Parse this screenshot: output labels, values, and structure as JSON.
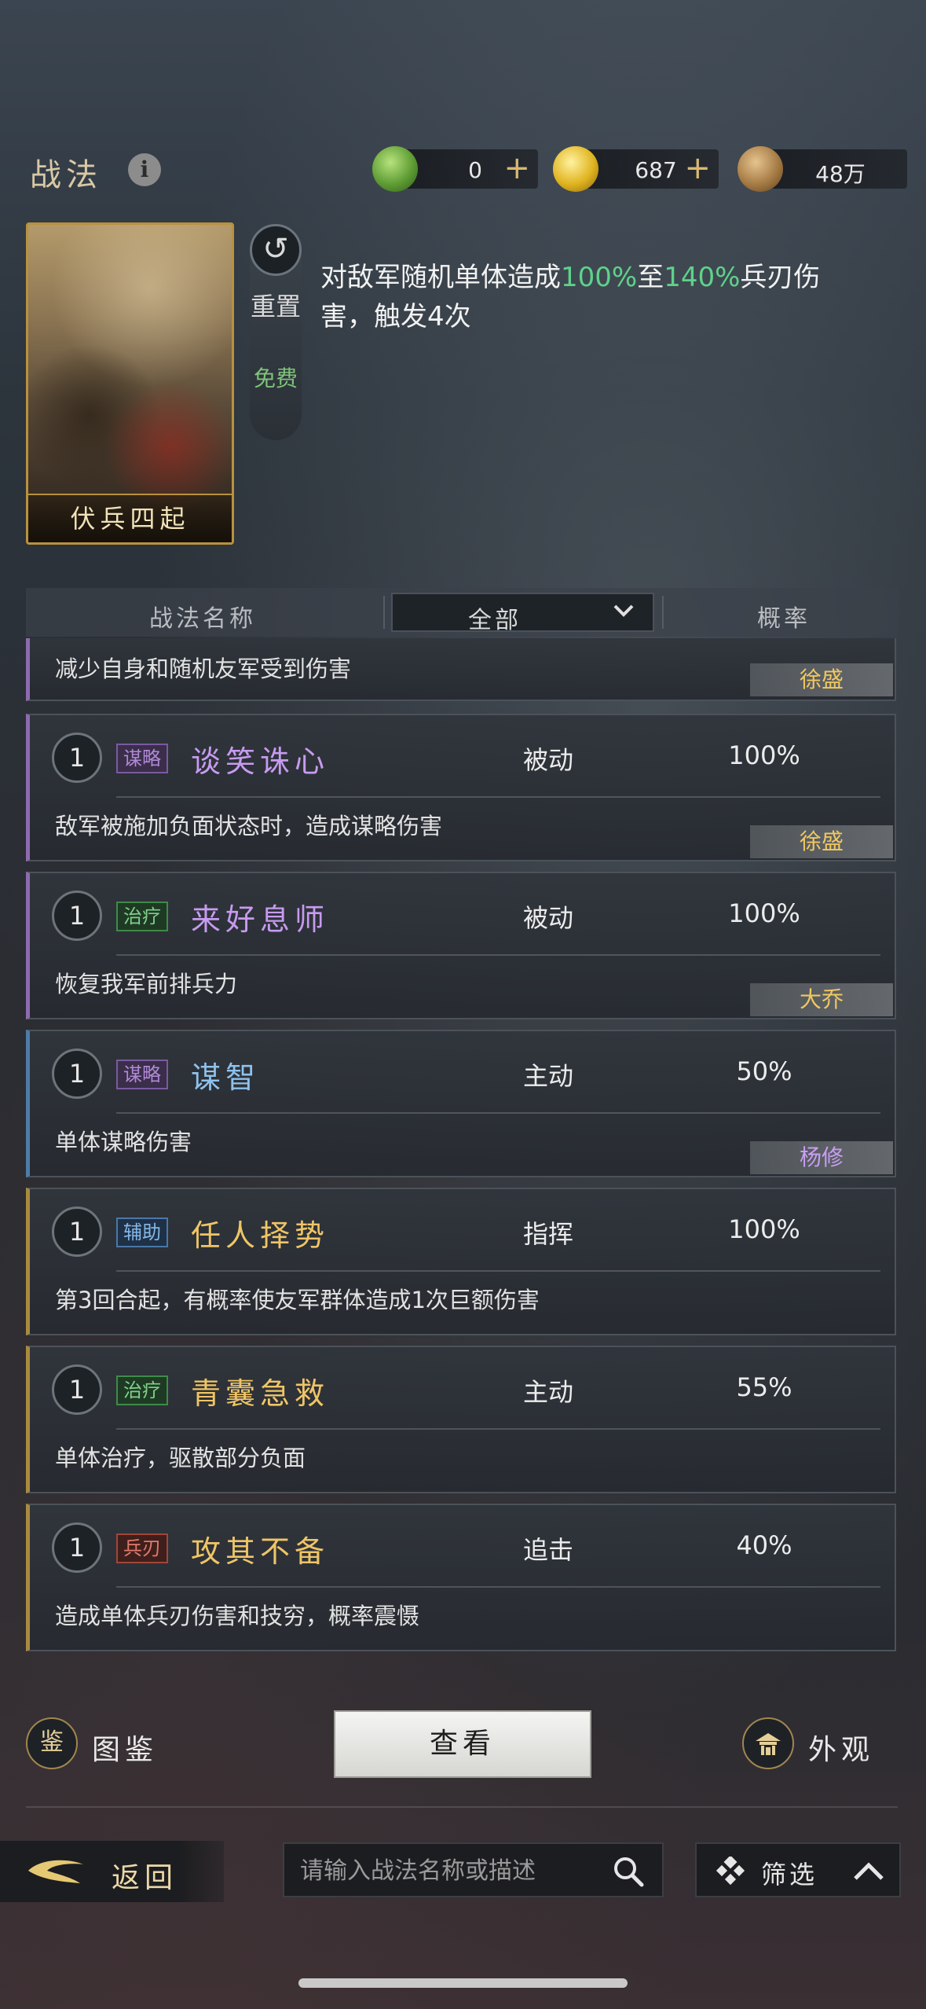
{
  "header": {
    "title": "战法",
    "currencies": [
      {
        "icon": "jade-coin-icon",
        "value": "0",
        "color": "#6fb84a"
      },
      {
        "icon": "gold-coin-icon",
        "value": "687",
        "color": "#e3b92a"
      },
      {
        "icon": "copper-coin-icon",
        "value": "48万",
        "color": "#a67c45"
      }
    ],
    "plus": "+"
  },
  "detail": {
    "card_name": "伏兵四起",
    "reset_label": "重置",
    "free_label": "免费",
    "desc_part1": "对敌军随机单体造成",
    "desc_pct1": "100%",
    "desc_part2": "至",
    "desc_pct2": "140%",
    "desc_part3": "兵刃伤害，触发4次"
  },
  "filter": {
    "col_name": "战法名称",
    "col_filter": "全部",
    "col_rate": "概率"
  },
  "partial": {
    "desc": "减少自身和随机友军受到伤害",
    "owner": "徐盛"
  },
  "skills": [
    {
      "level": "1",
      "tag": "谋略",
      "tag_class": "mou",
      "name": "谈笑诛心",
      "color": "purple",
      "type": "被动",
      "rate": "100%",
      "desc": "敌军被施加负面状态时，造成谋略伤害",
      "owner": "徐盛",
      "owner_color": "gold"
    },
    {
      "level": "1",
      "tag": "治疗",
      "tag_class": "zhi",
      "name": "来好息师",
      "color": "purple",
      "type": "被动",
      "rate": "100%",
      "desc": "恢复我军前排兵力",
      "owner": "大乔",
      "owner_color": "gold"
    },
    {
      "level": "1",
      "tag": "谋略",
      "tag_class": "mou",
      "name": "谋智",
      "color": "blue",
      "type": "主动",
      "rate": "50%",
      "desc": "单体谋略伤害",
      "owner": "杨修",
      "owner_color": "purple"
    },
    {
      "level": "1",
      "tag": "辅助",
      "tag_class": "fu",
      "name": "任人择势",
      "color": "gold",
      "type": "指挥",
      "rate": "100%",
      "desc": "第3回合起，有概率使友军群体造成1次巨额伤害",
      "owner": "",
      "owner_color": ""
    },
    {
      "level": "1",
      "tag": "治疗",
      "tag_class": "zhi",
      "name": "青囊急救",
      "color": "gold",
      "type": "主动",
      "rate": "55%",
      "desc": "单体治疗，驱散部分负面",
      "owner": "",
      "owner_color": ""
    },
    {
      "level": "1",
      "tag": "兵刃",
      "tag_class": "bing",
      "name": "攻其不备",
      "color": "gold",
      "type": "追击",
      "rate": "40%",
      "desc": "造成单体兵刃伤害和技穷，概率震慑",
      "owner": "",
      "owner_color": ""
    }
  ],
  "bottom": {
    "gallery_label": "图鉴",
    "gallery_icon_glyph": "鉴",
    "view_label": "查看",
    "appearance_label": "外观",
    "back_label": "返回",
    "search_placeholder": "请输入战法名称或描述",
    "filter_label": "筛选"
  }
}
